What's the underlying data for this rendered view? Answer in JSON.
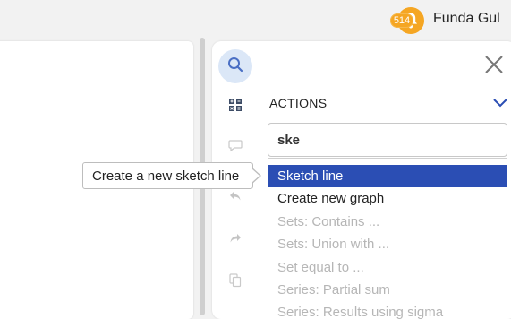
{
  "header": {
    "notification_count": "514",
    "user_name": "Funda Gul"
  },
  "colors": {
    "accent": "#2b4eb4",
    "notification": "#f5a623",
    "search_button_bg": "#dbe7f7"
  },
  "sidebar": {
    "icons": [
      "search-icon",
      "formula-grid-icon",
      "comment-icon",
      "undo-icon",
      "redo-icon",
      "copy-icon"
    ]
  },
  "actions_panel": {
    "title": "ACTIONS",
    "search_value": "ske",
    "results": [
      {
        "label": "Sketch line",
        "state": "selected"
      },
      {
        "label": "Create new graph",
        "state": "enabled"
      },
      {
        "label": "Sets: Contains ...",
        "state": "disabled"
      },
      {
        "label": "Sets: Union with ...",
        "state": "disabled"
      },
      {
        "label": "Set equal to ...",
        "state": "disabled"
      },
      {
        "label": "Series: Partial sum",
        "state": "disabled"
      },
      {
        "label": "Series: Results using sigma",
        "state": "disabled"
      }
    ]
  },
  "tooltip": {
    "text": "Create a new sketch line"
  }
}
